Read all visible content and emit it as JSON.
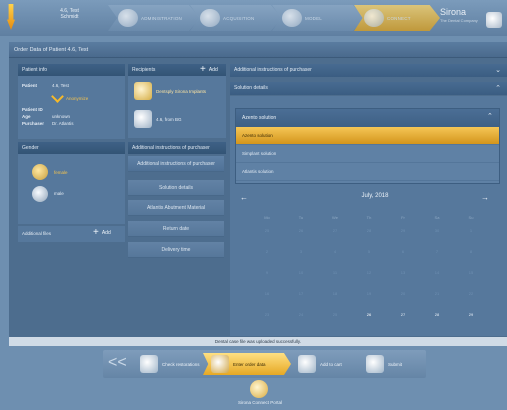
{
  "patient": {
    "name_line1": "4.6, Test",
    "name_line2": "Schmidt"
  },
  "workflow_steps": [
    {
      "label": "ADMINISTRATION",
      "active": false
    },
    {
      "label": "ACQUISITION",
      "active": false
    },
    {
      "label": "MODEL",
      "active": false
    },
    {
      "label": "CONNECT",
      "active": true
    }
  ],
  "brand": {
    "name": "Sirona",
    "sub": "The Dental Company"
  },
  "main": {
    "title": "Order Data of Patient 4.6, Test"
  },
  "patient_info": {
    "header": "Patient info",
    "patient_label": "Patient",
    "patient_value": "4.6, Test",
    "anonymize_label": "Anonymize",
    "patient_id_label": "Patient ID",
    "age_label": "Age",
    "age_value": "unknown",
    "purchaser_label": "Purchaser",
    "purchaser_value": "Dr. Atlantis"
  },
  "gender": {
    "header": "Gender",
    "female_label": "female",
    "male_label": "male"
  },
  "additional_files": {
    "label": "Additional files",
    "add_label": "Add"
  },
  "recipients": {
    "header": "Recipients",
    "add_label": "Add",
    "items": [
      {
        "name": "Dentsply Sirona Implants",
        "selected": true
      },
      {
        "name": "4.6, from BG",
        "selected": false
      }
    ]
  },
  "nav": {
    "header": "Additional instructions of purchaser",
    "items": [
      "Additional instructions of purchaser",
      "Solution details",
      "Atlantis Abutment Material",
      "Return date",
      "Delivery time"
    ]
  },
  "sections": {
    "additional_instructions": "Additional instructions of purchaser",
    "solution_details": "Solution details"
  },
  "dropdown": {
    "selected_label": "Azento solution",
    "options": [
      "Azento solution",
      "Simplant solution",
      "Atlantis solution"
    ]
  },
  "calendar": {
    "prev": "←",
    "next": "→",
    "title": "July, 2018",
    "days_of_week": [
      "Mo",
      "Tu",
      "We",
      "Th",
      "Fr",
      "Sa",
      "Su"
    ],
    "weeks": [
      [
        "25",
        "26",
        "27",
        "28",
        "29",
        "30",
        "1"
      ],
      [
        "2",
        "3",
        "4",
        "5",
        "6",
        "7",
        "8"
      ],
      [
        "9",
        "10",
        "11",
        "12",
        "13",
        "14",
        "15"
      ],
      [
        "16",
        "17",
        "18",
        "19",
        "20",
        "21",
        "22"
      ],
      [
        "23",
        "24",
        "25",
        "26",
        "27",
        "28",
        "29"
      ]
    ],
    "selected_day": "26"
  },
  "status": {
    "message": "Dental case file was uploaded successfully."
  },
  "wizard": {
    "back": "<<",
    "steps": [
      {
        "label": "Check restorations",
        "active": false
      },
      {
        "label": "Enter order data",
        "active": true
      },
      {
        "label": "Add to cart",
        "active": false
      },
      {
        "label": "Submit",
        "active": false
      }
    ]
  },
  "portal": {
    "label": "Sirona Connect Portal"
  }
}
